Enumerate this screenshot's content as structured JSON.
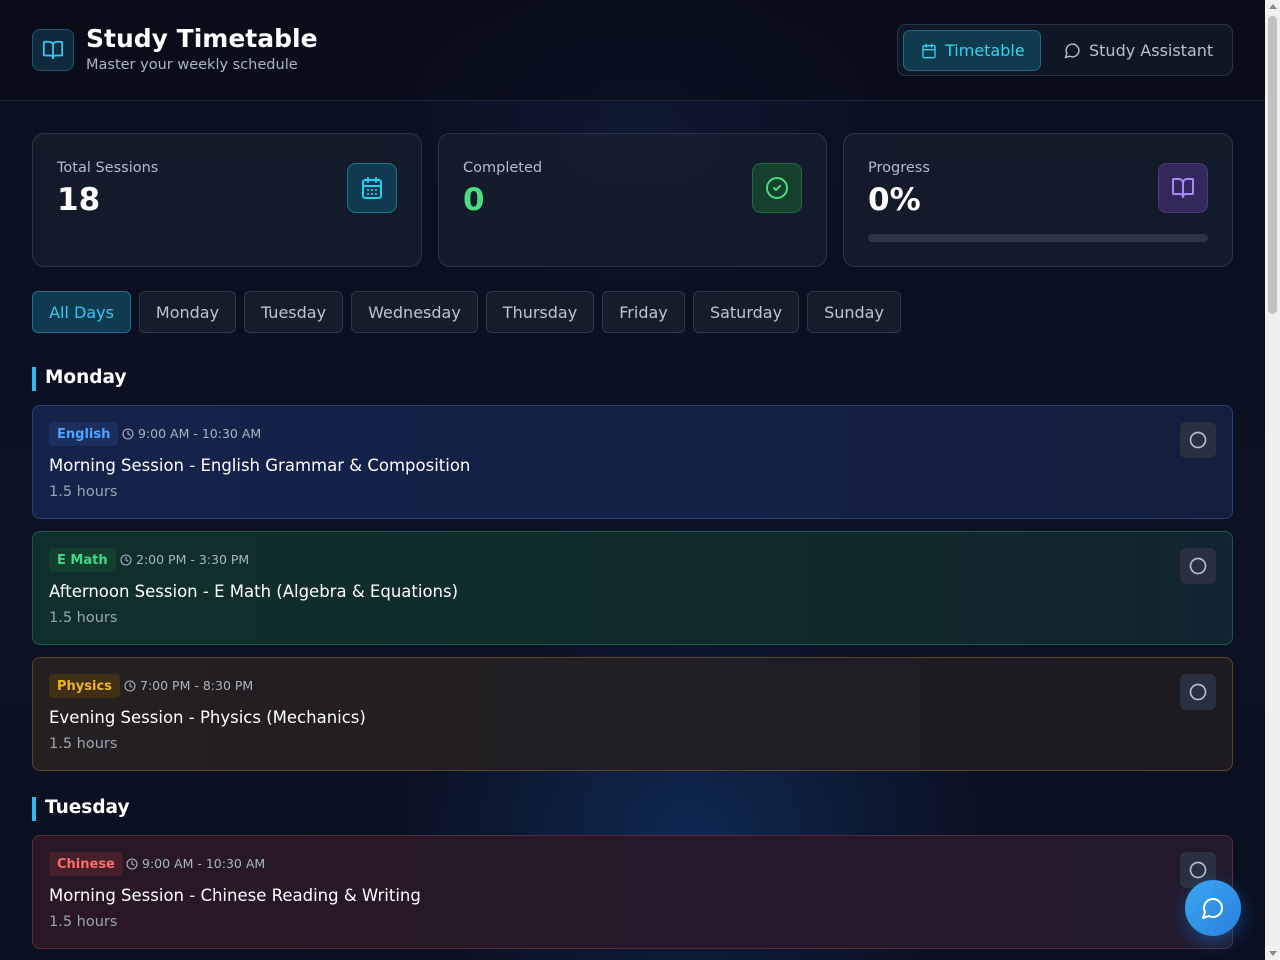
{
  "header": {
    "title": "Study Timetable",
    "subtitle": "Master your weekly schedule",
    "logo_icon": "book-open-icon",
    "views": [
      {
        "label": "Timetable",
        "icon": "calendar-icon",
        "active": true
      },
      {
        "label": "Study Assistant",
        "icon": "chat-bubble-icon",
        "active": false
      }
    ]
  },
  "stats": {
    "total": {
      "label": "Total Sessions",
      "value": "18",
      "icon": "calendar-icon",
      "color": "#22d3ee"
    },
    "completed": {
      "label": "Completed",
      "value": "0",
      "icon": "check-circle-icon",
      "color": "#4ade80"
    },
    "progress": {
      "label": "Progress",
      "value": "0%",
      "icon": "book-open-icon",
      "color": "#a78bfa",
      "fraction": 0
    }
  },
  "day_filters": [
    "All Days",
    "Monday",
    "Tuesday",
    "Wednesday",
    "Thursday",
    "Friday",
    "Saturday",
    "Sunday"
  ],
  "active_filter": "All Days",
  "days": [
    {
      "name": "Monday",
      "sessions": [
        {
          "subject": "English",
          "time": "9:00 AM - 10:30 AM",
          "title": "Morning Session - English Grammar & Composition",
          "duration": "1.5 hours",
          "color": "blue"
        },
        {
          "subject": "E Math",
          "time": "2:00 PM - 3:30 PM",
          "title": "Afternoon Session - E Math (Algebra & Equations)",
          "duration": "1.5 hours",
          "color": "green"
        },
        {
          "subject": "Physics",
          "time": "7:00 PM - 8:30 PM",
          "title": "Evening Session - Physics (Mechanics)",
          "duration": "1.5 hours",
          "color": "amber"
        }
      ]
    },
    {
      "name": "Tuesday",
      "sessions": [
        {
          "subject": "Chinese",
          "time": "9:00 AM - 10:30 AM",
          "title": "Morning Session - Chinese Reading & Writing",
          "duration": "1.5 hours",
          "color": "red"
        }
      ]
    }
  ],
  "fab": {
    "icon": "chat-bubble-icon"
  },
  "colors": {
    "accent": "#38bdf8",
    "background": "#0b1020"
  }
}
